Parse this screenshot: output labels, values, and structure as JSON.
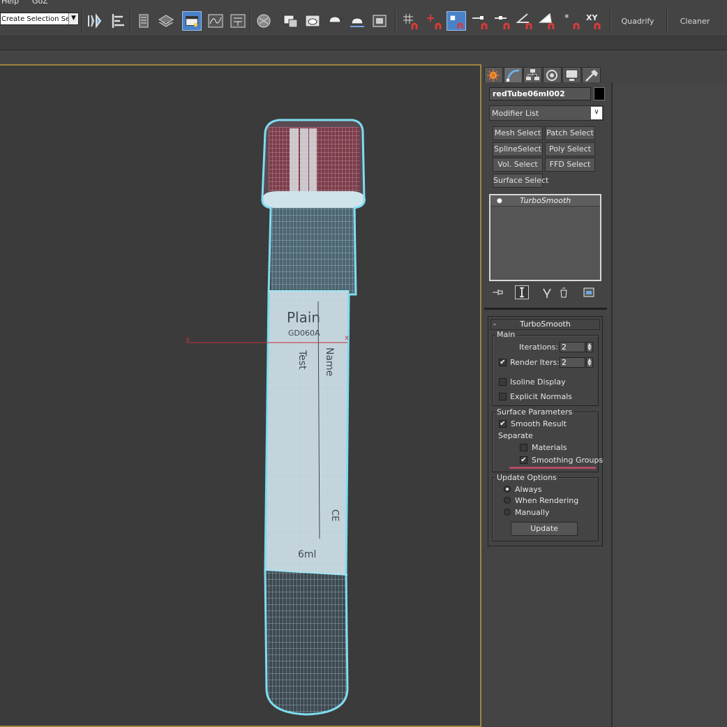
{
  "menubar": {
    "items": [
      "Help",
      "GoZ"
    ]
  },
  "toolbar": {
    "selection_set": "Create Selection Se",
    "quadrify_label": "Quadrify",
    "cleaner_label": "Cleaner"
  },
  "viewport": {
    "axis_x": "x",
    "axis_y": "y",
    "tube_texts": {
      "brand": "Plain",
      "code": "GD060A",
      "test": "Test",
      "name": "Name",
      "volume": "6ml",
      "ce": "CE"
    }
  },
  "command_panel": {
    "tabs": [
      "create-icon",
      "modify-icon",
      "hierarchy-icon",
      "motion-icon",
      "display-icon",
      "utilities-icon"
    ],
    "object_name": "redTube06ml002",
    "modifier_list": "Modifier List",
    "modifier_buttons": [
      "Mesh Select",
      "Patch Select",
      "SplineSelect",
      "Poly Select",
      "Vol. Select",
      "FFD Select",
      "Surface Select"
    ],
    "stack": {
      "item": "TurboSmooth"
    }
  },
  "turbosmooth": {
    "title": "TurboSmooth",
    "main": {
      "title": "Main",
      "iterations_label": "Iterations:",
      "iterations": "2",
      "render_iters_label": "Render Iters:",
      "render_iters": "2",
      "render_iters_checked": true,
      "isoline": "Isoline Display",
      "explicit": "Explicit Normals"
    },
    "surface": {
      "title": "Surface Parameters",
      "smooth_result": "Smooth Result",
      "separate": "Separate",
      "materials": "Materials",
      "smoothing_groups": "Smoothing Groups"
    },
    "update": {
      "title": "Update Options",
      "always": "Always",
      "when_rendering": "When Rendering",
      "manually": "Manually",
      "button": "Update",
      "selected": "Always"
    }
  },
  "colors": {
    "accent": "#4a82c9",
    "viewport_border": "#9c8640",
    "wire": "#7fdcf0",
    "highlight": "#b94a62"
  }
}
